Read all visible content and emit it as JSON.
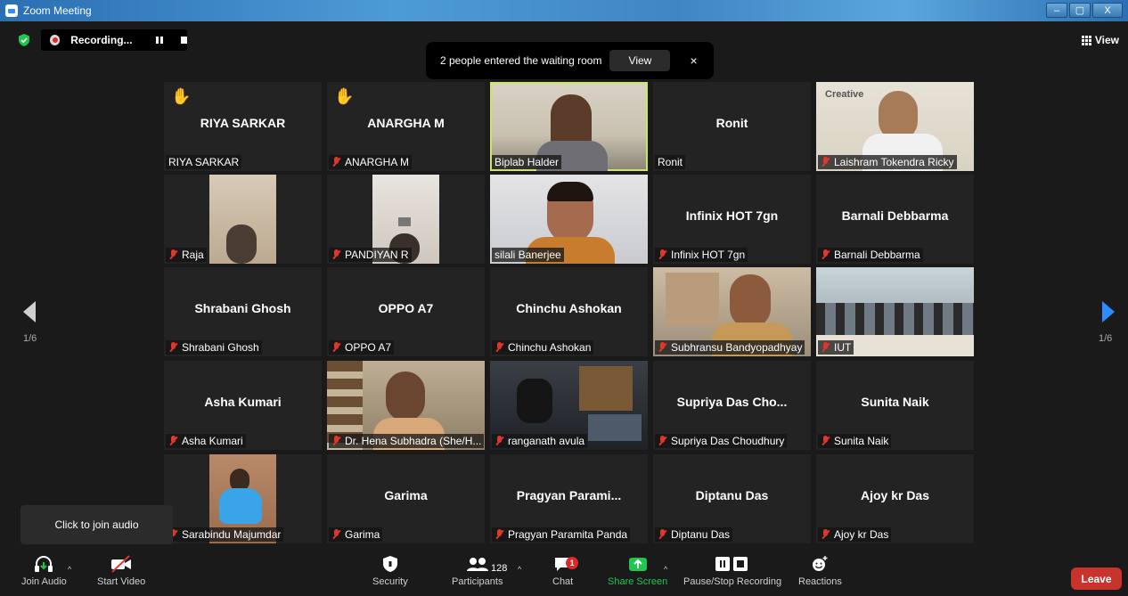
{
  "window": {
    "title": "Zoom Meeting",
    "min": "–",
    "max": "▢",
    "close": "X"
  },
  "recording": {
    "label": "Recording..."
  },
  "view": {
    "label": "View"
  },
  "waiting_banner": {
    "text": "2 people entered the waiting room",
    "view": "View",
    "close": "×"
  },
  "pagination": {
    "left": "1/6",
    "right": "1/6"
  },
  "tiles": [
    {
      "big": "RIYA SARKAR",
      "name": "RIYA SARKAR",
      "hand": true,
      "muted": false
    },
    {
      "big": "ANARGHA M",
      "name": "ANARGHA M",
      "hand": true,
      "muted": true
    },
    {
      "big": "",
      "name": "Biplab Halder",
      "video": true,
      "muted": false,
      "active": true
    },
    {
      "big": "Ronit",
      "name": "Ronit",
      "muted": false
    },
    {
      "big": "",
      "name": "Laishram Tokendra Ricky",
      "video": true,
      "muted": true
    },
    {
      "big": "",
      "name": "Raja",
      "video": true,
      "muted": true
    },
    {
      "big": "",
      "name": "PANDIYAN R",
      "video": true,
      "muted": true
    },
    {
      "big": "",
      "name": "silali Banerjee",
      "video": true,
      "muted": false
    },
    {
      "big": "Infinix HOT 7gn",
      "name": "Infinix HOT 7gn",
      "muted": true
    },
    {
      "big": "Barnali Debbarma",
      "name": "Barnali Debbarma",
      "muted": true
    },
    {
      "big": "Shrabani Ghosh",
      "name": "Shrabani Ghosh",
      "muted": true
    },
    {
      "big": "OPPO A7",
      "name": "OPPO A7",
      "muted": true
    },
    {
      "big": "Chinchu Ashokan",
      "name": "Chinchu Ashokan",
      "muted": true
    },
    {
      "big": "",
      "name": "Subhransu Bandyopadhyay",
      "video": true,
      "muted": true
    },
    {
      "big": "",
      "name": "IUT",
      "video": true,
      "muted": true
    },
    {
      "big": "Asha Kumari",
      "name": "Asha Kumari",
      "muted": true
    },
    {
      "big": "",
      "name": "Dr. Hena Subhadra (She/H...",
      "video": true,
      "muted": true
    },
    {
      "big": "",
      "name": "ranganath avula",
      "video": true,
      "muted": true
    },
    {
      "big": "Supriya Das Cho...",
      "name": "Supriya Das Choudhury",
      "muted": true
    },
    {
      "big": "Sunita Naik",
      "name": "Sunita Naik",
      "muted": true
    },
    {
      "big": "",
      "name": "Sarabindu Majumdar",
      "video": true,
      "muted": true
    },
    {
      "big": "Garima",
      "name": "Garima",
      "muted": true
    },
    {
      "big": "Pragyan Parami...",
      "name": "Pragyan Paramita Panda",
      "muted": true
    },
    {
      "big": "Diptanu Das",
      "name": "Diptanu Das",
      "muted": true
    },
    {
      "big": "Ajoy kr Das",
      "name": "Ajoy kr Das",
      "muted": true
    }
  ],
  "tooltip": "Click to join audio",
  "toolbar": {
    "join_audio": "Join Audio",
    "start_video": "Start Video",
    "security": "Security",
    "participants": "Participants",
    "participants_count": "128",
    "chat": "Chat",
    "chat_badge": "1",
    "share_screen": "Share Screen",
    "pause_stop_recording": "Pause/Stop Recording",
    "reactions": "Reactions",
    "leave": "Leave"
  },
  "colors": {
    "accent": "#2d8cff",
    "share": "#1fc74d",
    "leave": "#c8332c",
    "active_speaker": "#cde36b",
    "muted": "#e0362c"
  }
}
